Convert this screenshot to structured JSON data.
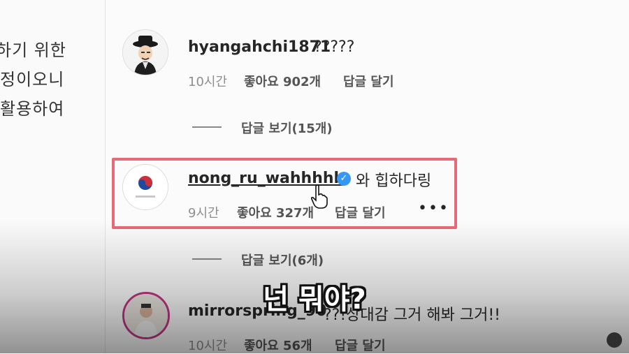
{
  "left_text": {
    "line1": "하기  위한",
    "line2": "정이오니",
    "line3": "활용하여"
  },
  "comments": [
    {
      "username": "hyangahchi1871",
      "text": "?????",
      "time": "10시간",
      "likes": "좋아요 902개",
      "reply": "답글 달기",
      "view_replies": "답글 보기(15개)"
    },
    {
      "username": "nong_ru_wahhhhh",
      "text": "와 힙하다링",
      "time": "9시간",
      "likes": "좋아요 327개",
      "reply": "답글 달기",
      "more": "•••",
      "verified_icon": "verified-check",
      "view_replies": "답글 보기(6개)"
    },
    {
      "username": "mirrorspring_90",
      "text": "??!상대감 그거 해봐 그거!!",
      "time": "10시간",
      "likes": "좋아요 56개",
      "reply": "답글 달기"
    }
  ],
  "subtitle": "넌 뭐야?",
  "colors": {
    "highlight_border": "#e86a78",
    "verified": "#3897f0",
    "story_ring": "#c13584"
  }
}
